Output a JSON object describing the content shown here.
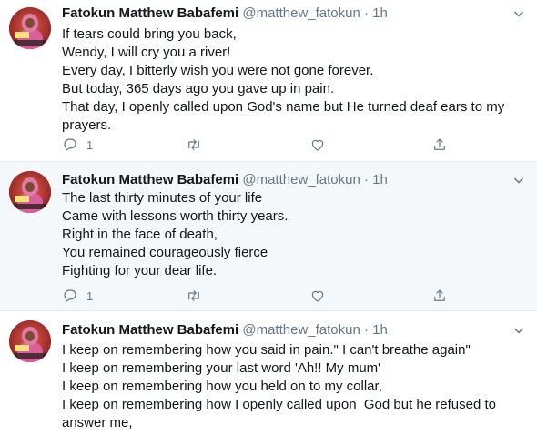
{
  "tweets": [
    {
      "name": "Fatokun Matthew Babafemi",
      "handle": "@matthew_fatokun",
      "dot": "·",
      "time": "1h",
      "lines": [
        "If tears could bring you back,",
        "Wendy, I will cry you a river!",
        "Every day, I bitterly wish you were not gone forever.",
        "But today, 365 days ago you gave up in pain.",
        "That day, I openly called upon God's name but He turned deaf ears to my",
        "prayers."
      ],
      "reply_count": "1"
    },
    {
      "name": "Fatokun Matthew Babafemi",
      "handle": "@matthew_fatokun",
      "dot": "·",
      "time": "1h",
      "lines": [
        "The last thirty minutes of your life",
        "Came with lessons worth thirty years.",
        "Right in the face of death,",
        "You remained courageously fierce",
        "Fighting for your dear life."
      ],
      "reply_count": "1"
    },
    {
      "name": "Fatokun Matthew Babafemi",
      "handle": "@matthew_fatokun",
      "dot": "·",
      "time": "1h",
      "lines": [
        "I keep on remembering how you said in pain.\" I can't breathe again\"",
        "I keep on remembering your last word 'Ah!! My mum'",
        "I keep on remembering how you held on to my collar,",
        "I keep on remembering how I openly called upon  God but he refused to",
        "answer me,"
      ]
    }
  ],
  "icons": {
    "reply": "reply-icon",
    "retweet": "retweet-icon",
    "like": "heart-icon",
    "share": "share-icon",
    "more": "chevron-down-icon"
  },
  "colors": {
    "name": "#14171a",
    "meta": "#657786",
    "highlight_bg": "#f5f8fa",
    "divider": "#e6ecf0"
  }
}
